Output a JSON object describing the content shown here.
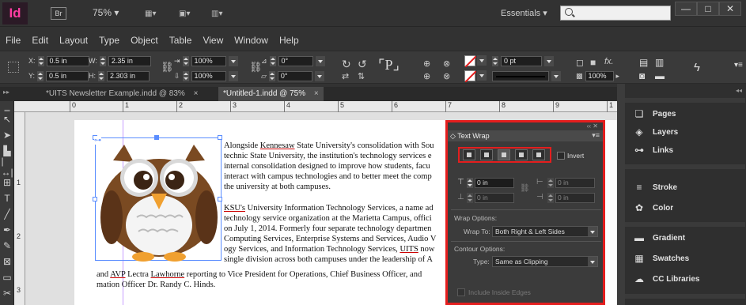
{
  "app": {
    "logo": "Id",
    "bridge": "Br",
    "zoom": "75%",
    "zoom_arrow": "▾",
    "workspace": "Essentials",
    "workspace_arrow": "▾",
    "colors": {
      "accent": "#ff3da2",
      "highlight": "#e41e1e"
    }
  },
  "window_controls": {
    "minimize": "—",
    "maximize": "□",
    "close": "✕"
  },
  "menu": [
    "File",
    "Edit",
    "Layout",
    "Type",
    "Object",
    "Table",
    "View",
    "Window",
    "Help"
  ],
  "control": {
    "x_label": "X:",
    "x_value": "0.5 in",
    "y_label": "Y:",
    "y_value": "0.5 in",
    "w_label": "W:",
    "w_value": "2.35 in",
    "h_label": "H:",
    "h_value": "2.303 in",
    "scale_x": "100%",
    "scale_y": "100%",
    "rotate": "0°",
    "shear": "0°",
    "stroke_weight": "0 pt",
    "opacity": "100%"
  },
  "tabs": [
    {
      "label": "*UITS Newsletter Example.indd @ 83%",
      "close": "×"
    },
    {
      "label": "*Untitled-1.indd @ 75%",
      "close": "×"
    }
  ],
  "ruler": {
    "top": [
      "0",
      "1",
      "2",
      "3",
      "4",
      "5",
      "6",
      "7",
      "8",
      "9",
      "1"
    ],
    "left": [
      "1",
      "2",
      "3"
    ]
  },
  "document": {
    "p1": [
      [
        "Alongside ",
        "Kennesaw",
        " State University's consolidation with Sou"
      ],
      [
        "technic State University, the institution's technology services e"
      ],
      [
        "internal consolidation designed to improve how students, facu"
      ],
      [
        "interact with campus technologies and to better meet the comp"
      ],
      [
        "the university at both campuses."
      ]
    ],
    "p2": [
      [
        "KSU's",
        " University Information Technology Services, a name ad"
      ],
      [
        "technology service organization at the Marietta Campus, offici"
      ],
      [
        "on July 1, 2014. Formerly four separate technology departmen"
      ],
      [
        "Computing Services, Enterprise Systems and Services, Audio V"
      ],
      [
        "ogy Services, and Information Technology Services, ",
        "UITS",
        " now"
      ],
      [
        "single division across both campuses under the leadership of A"
      ],
      [
        "and ",
        "AVP",
        " Lectra ",
        "Lawhorne",
        " reporting to Vice President for Operations, Chief Business Officer, and"
      ],
      [
        "mation Officer Dr. Randy C. Hinds."
      ]
    ]
  },
  "text_wrap": {
    "collapse": "‹‹ ✕",
    "title": "◇ Text Wrap",
    "menu": "▾≡",
    "invert_label": "Invert",
    "offset_top": "0 in",
    "offset_bottom": "0 in",
    "offset_left": "0 in",
    "offset_right": "0 in",
    "wrap_options_label": "Wrap Options:",
    "wrap_to_label": "Wrap To:",
    "wrap_to_value": "Both Right & Left Sides",
    "contour_options_label": "Contour Options:",
    "type_label": "Type:",
    "type_value": "Same as Clipping",
    "include_inside_edges_label": "Include Inside Edges"
  },
  "right_panels": [
    {
      "label": "Pages",
      "icon": "pages-icon"
    },
    {
      "label": "Layers",
      "icon": "layers-icon"
    },
    {
      "label": "Links",
      "icon": "links-icon"
    },
    {
      "label": "Stroke",
      "icon": "stroke-icon"
    },
    {
      "label": "Color",
      "icon": "color-icon"
    },
    {
      "label": "Gradient",
      "icon": "gradient-icon"
    },
    {
      "label": "Swatches",
      "icon": "swatches-icon"
    },
    {
      "label": "CC Libraries",
      "icon": "cc-libraries-icon"
    }
  ]
}
